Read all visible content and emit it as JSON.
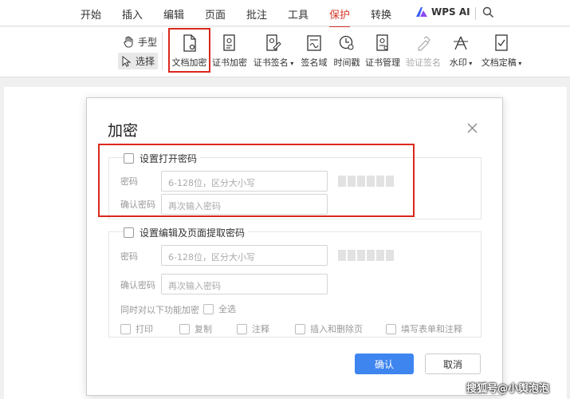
{
  "menu": {
    "items": [
      {
        "label": "开始",
        "active": false
      },
      {
        "label": "插入",
        "active": false
      },
      {
        "label": "编辑",
        "active": false
      },
      {
        "label": "页面",
        "active": false
      },
      {
        "label": "批注",
        "active": false
      },
      {
        "label": "工具",
        "active": false
      },
      {
        "label": "保护",
        "active": true
      },
      {
        "label": "转换",
        "active": false
      }
    ],
    "ai_label": "WPS AI"
  },
  "toolbar": {
    "hand_label": "手型",
    "select_label": "选择",
    "buttons": [
      {
        "label": "文档加密",
        "icon": "lock-document-icon",
        "disabled": false
      },
      {
        "label": "证书加密",
        "icon": "certificate-lock-icon",
        "disabled": false
      },
      {
        "label": "证书签名",
        "icon": "certificate-sign-icon",
        "disabled": false,
        "dropdown": true
      },
      {
        "label": "签名域",
        "icon": "signature-field-icon",
        "disabled": false
      },
      {
        "label": "时间戳",
        "icon": "timestamp-icon",
        "disabled": false
      },
      {
        "label": "证书管理",
        "icon": "certificate-manage-icon",
        "disabled": false
      },
      {
        "label": "验证签名",
        "icon": "verify-signature-icon",
        "disabled": true
      },
      {
        "label": "水印",
        "icon": "watermark-icon",
        "disabled": false,
        "dropdown": true
      },
      {
        "label": "文档定稿",
        "icon": "finalize-icon",
        "disabled": false,
        "dropdown": true
      }
    ]
  },
  "dialog": {
    "title": "加密",
    "open_password": {
      "checkbox_label": "设置打开密码",
      "password_label": "密码",
      "password_placeholder": "6-128位，区分大小写",
      "confirm_label": "确认密码",
      "confirm_placeholder": "再次输入密码"
    },
    "edit_password": {
      "checkbox_label": "设置编辑及页面提取密码",
      "password_label": "密码",
      "password_placeholder": "6-128位，区分大小写",
      "confirm_label": "确认密码",
      "confirm_placeholder": "再次输入密码",
      "perm_intro": "同时对以下功能加密",
      "select_all": "全选",
      "permissions": [
        "打印",
        "复制",
        "注释",
        "插入和删除页",
        "填写表单和注释"
      ]
    },
    "ok_label": "确认",
    "cancel_label": "取消"
  },
  "watermark_text": "搜狐号@小舆泡泡",
  "colors": {
    "accent_red": "#d4382b",
    "highlight": "#d9281c",
    "primary": "#3e85f0"
  }
}
